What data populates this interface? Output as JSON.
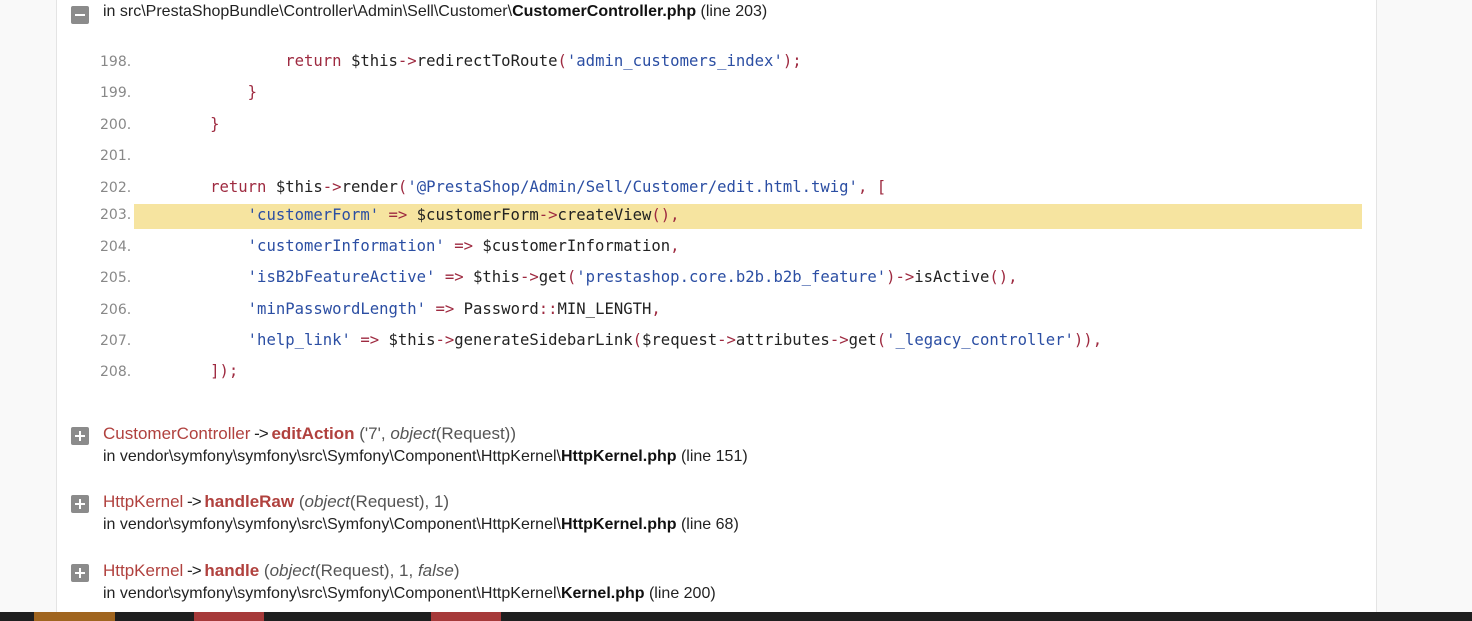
{
  "current_frame": {
    "path_prefix": "in src\\PrestaShopBundle\\Controller\\Admin\\Sell\\Customer\\",
    "file": "CustomerController.php",
    "line_info": "(line 203)"
  },
  "code_lines": [
    {
      "num": "198.",
      "tokens": [
        [
          "",
          "                "
        ],
        [
          "k",
          "return"
        ],
        [
          "",
          " $this"
        ],
        [
          "k",
          "->"
        ],
        [
          "",
          "redirectToRoute"
        ],
        [
          "k",
          "("
        ],
        [
          "s",
          "'admin_customers_index'"
        ],
        [
          "k",
          ");"
        ]
      ]
    },
    {
      "num": "199.",
      "tokens": [
        [
          "",
          "            "
        ],
        [
          "k",
          "}"
        ]
      ]
    },
    {
      "num": "200.",
      "tokens": [
        [
          "",
          "        "
        ],
        [
          "k",
          "}"
        ]
      ]
    },
    {
      "num": "201.",
      "tokens": []
    },
    {
      "num": "202.",
      "tokens": [
        [
          "",
          "        "
        ],
        [
          "k",
          "return"
        ],
        [
          "",
          " $this"
        ],
        [
          "k",
          "->"
        ],
        [
          "",
          "render"
        ],
        [
          "k",
          "("
        ],
        [
          "s",
          "'@PrestaShop/Admin/Sell/Customer/edit.html.twig'"
        ],
        [
          "k",
          ", ["
        ]
      ]
    },
    {
      "num": "203.",
      "highlight": true,
      "tokens": [
        [
          "",
          "            "
        ],
        [
          "s",
          "'customerForm'"
        ],
        [
          "",
          " "
        ],
        [
          "k",
          "=>"
        ],
        [
          "",
          " $customerForm"
        ],
        [
          "k",
          "->"
        ],
        [
          "",
          "createView"
        ],
        [
          "k",
          "(),"
        ]
      ]
    },
    {
      "num": "204.",
      "tokens": [
        [
          "",
          "            "
        ],
        [
          "s",
          "'customerInformation'"
        ],
        [
          "",
          " "
        ],
        [
          "k",
          "=>"
        ],
        [
          "",
          " $customerInformation"
        ],
        [
          "k",
          ","
        ]
      ]
    },
    {
      "num": "205.",
      "tokens": [
        [
          "",
          "            "
        ],
        [
          "s",
          "'isB2bFeatureActive'"
        ],
        [
          "",
          " "
        ],
        [
          "k",
          "=>"
        ],
        [
          "",
          " $this"
        ],
        [
          "k",
          "->"
        ],
        [
          "",
          "get"
        ],
        [
          "k",
          "("
        ],
        [
          "s",
          "'prestashop.core.b2b.b2b_feature'"
        ],
        [
          "k",
          ")->"
        ],
        [
          "",
          "isActive"
        ],
        [
          "k",
          "(),"
        ]
      ]
    },
    {
      "num": "206.",
      "tokens": [
        [
          "",
          "            "
        ],
        [
          "s",
          "'minPasswordLength'"
        ],
        [
          "",
          " "
        ],
        [
          "k",
          "=>"
        ],
        [
          "",
          " Password"
        ],
        [
          "k",
          "::"
        ],
        [
          "",
          "MIN_LENGTH"
        ],
        [
          "k",
          ","
        ]
      ]
    },
    {
      "num": "207.",
      "tokens": [
        [
          "",
          "            "
        ],
        [
          "s",
          "'help_link'"
        ],
        [
          "",
          " "
        ],
        [
          "k",
          "=>"
        ],
        [
          "",
          " $this"
        ],
        [
          "k",
          "->"
        ],
        [
          "",
          "generateSidebarLink"
        ],
        [
          "k",
          "("
        ],
        [
          "",
          "$request"
        ],
        [
          "k",
          "->"
        ],
        [
          "",
          "attributes"
        ],
        [
          "k",
          "->"
        ],
        [
          "",
          "get"
        ],
        [
          "k",
          "("
        ],
        [
          "s",
          "'_legacy_controller'"
        ],
        [
          "k",
          ")),"
        ]
      ]
    },
    {
      "num": "208.",
      "tokens": [
        [
          "",
          "        "
        ],
        [
          "k",
          "]);"
        ]
      ]
    }
  ],
  "trace": [
    {
      "class": "CustomerController",
      "arrow": "->",
      "method": "editAction",
      "args_html": "('7', <i>object</i>(Request))",
      "path_prefix": "in vendor\\symfony\\symfony\\src\\Symfony\\Component\\HttpKernel\\",
      "file": "HttpKernel.php",
      "line_info": "(line 151)"
    },
    {
      "class": "HttpKernel",
      "arrow": "->",
      "method": "handleRaw",
      "args_html": "(<i>object</i>(Request), 1)",
      "path_prefix": "in vendor\\symfony\\symfony\\src\\Symfony\\Component\\HttpKernel\\",
      "file": "HttpKernel.php",
      "line_info": "(line 68)"
    },
    {
      "class": "HttpKernel",
      "arrow": "->",
      "method": "handle",
      "args_html": "(<i>object</i>(Request), 1, <i>false</i>)",
      "path_prefix": "in vendor\\symfony\\symfony\\src\\Symfony\\Component\\HttpKernel\\",
      "file": "Kernel.php",
      "line_info": "(line 200)"
    }
  ],
  "icons": {
    "collapse": "minus-square-icon",
    "expand": "plus-square-icon"
  },
  "colors": {
    "highlight": "#f6e4a0",
    "keyword": "#9e2a40",
    "string": "#2b4ea3",
    "class": "#b0413e"
  }
}
